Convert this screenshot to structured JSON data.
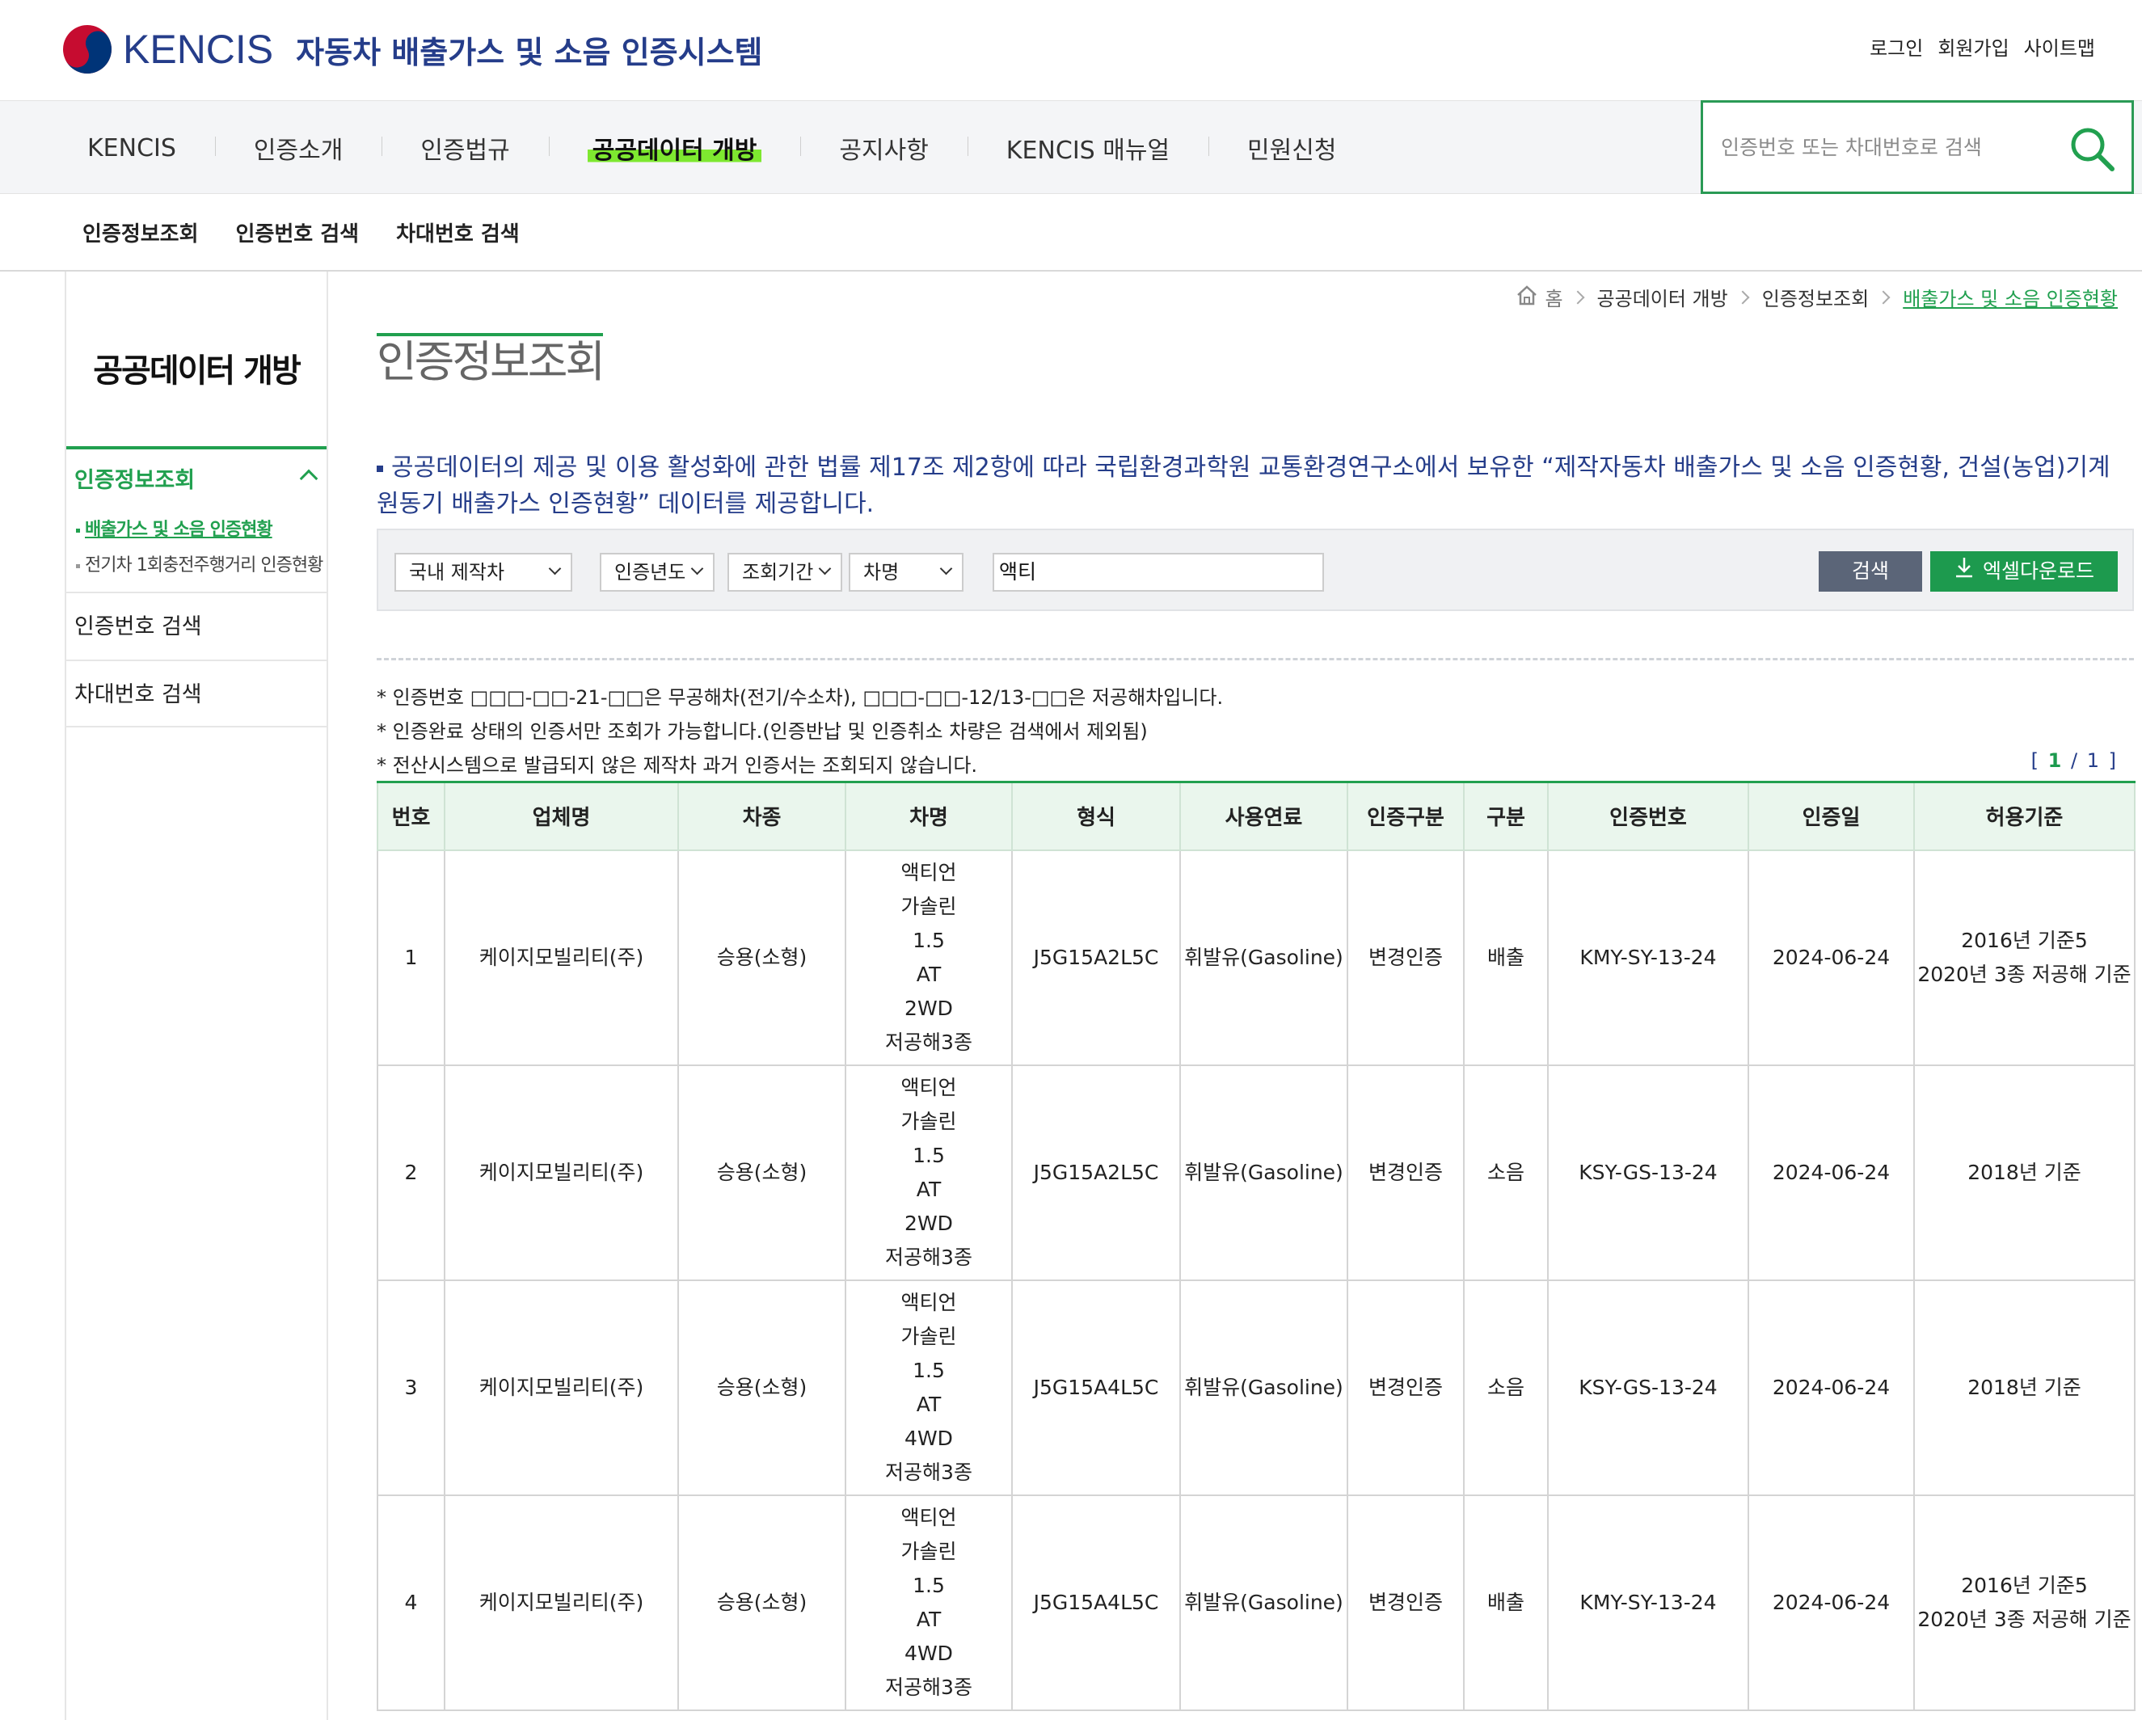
{
  "header": {
    "logo_text": "KENCIS",
    "site_title": "자동차 배출가스 및 소음 인증시스템",
    "util_links": [
      "로그인",
      "회원가입",
      "사이트맵"
    ]
  },
  "gnb": {
    "items": [
      "KENCIS",
      "인증소개",
      "인증법규",
      "공공데이터 개방",
      "공지사항",
      "KENCIS 매뉴얼",
      "민원신청"
    ],
    "active_index": 3,
    "search_placeholder": "인증번호 또는 차대번호로 검색"
  },
  "subnav": [
    "인증정보조회",
    "인증번호 검색",
    "차대번호 검색"
  ],
  "sidebar": {
    "title": "공공데이터 개방",
    "main": "인증정보조회",
    "subs": [
      "배출가스 및 소음 인증현황",
      "전기차 1회충전주행거리 인증현황"
    ],
    "items": [
      "인증번호 검색",
      "차대번호 검색"
    ]
  },
  "breadcrumb": [
    "홈",
    "공공데이터 개방",
    "인증정보조회",
    "배출가스 및 소음 인증현황"
  ],
  "page_title": "인증정보조회",
  "description": "공공데이터의 제공 및 이용 활성화에 관한 법률 제17조 제2항에 따라 국립환경과학원 교통환경연구소에서 보유한 “제작자동차 배출가스 및 소음 인증현황, 건설(농업)기계 원동기 배출가스 인증현황” 데이터를 제공합니다.",
  "filter": {
    "maker": "국내 제작차",
    "year": "인증년도",
    "period": "조회기간",
    "field": "차명",
    "keyword": "액티",
    "search_label": "검색",
    "excel_label": "엑셀다운로드"
  },
  "notes": [
    "* 인증번호 □□□-□□-21-□□은 무공해차(전기/수소차), □□□-□□-12/13-□□은 저공해차입니다.",
    "* 인증완료 상태의 인증서만 조회가 가능합니다.(인증반납 및 인증취소 차량은 검색에서 제외됨)",
    "* 전산시스템으로 발급되지 않은 제작차 과거 인증서는 조회되지 않습니다."
  ],
  "pager": {
    "current": "1",
    "total": "1"
  },
  "table": {
    "headers": [
      "번호",
      "업체명",
      "차종",
      "차명",
      "형식",
      "사용연료",
      "인증구분",
      "구분",
      "인증번호",
      "인증일",
      "허용기준"
    ],
    "rows": [
      {
        "no": "1",
        "company": "케이지모빌리티(주)",
        "type": "승용(소형)",
        "name": [
          "액티언",
          "가솔린",
          "1.5",
          "AT",
          "2WD",
          "저공해3종"
        ],
        "model": "J5G15A2L5C",
        "fuel": "휘발유(Gasoline)",
        "cert_kind": "변경인증",
        "category": "배출",
        "cert_no": "KMY-SY-13-24",
        "date": "2024-06-24",
        "standard": [
          "2016년 기준5",
          "2020년 3종 저공해 기준"
        ]
      },
      {
        "no": "2",
        "company": "케이지모빌리티(주)",
        "type": "승용(소형)",
        "name": [
          "액티언",
          "가솔린",
          "1.5",
          "AT",
          "2WD",
          "저공해3종"
        ],
        "model": "J5G15A2L5C",
        "fuel": "휘발유(Gasoline)",
        "cert_kind": "변경인증",
        "category": "소음",
        "cert_no": "KSY-GS-13-24",
        "date": "2024-06-24",
        "standard": [
          "2018년 기준"
        ]
      },
      {
        "no": "3",
        "company": "케이지모빌리티(주)",
        "type": "승용(소형)",
        "name": [
          "액티언",
          "가솔린",
          "1.5",
          "AT",
          "4WD",
          "저공해3종"
        ],
        "model": "J5G15A4L5C",
        "fuel": "휘발유(Gasoline)",
        "cert_kind": "변경인증",
        "category": "소음",
        "cert_no": "KSY-GS-13-24",
        "date": "2024-06-24",
        "standard": [
          "2018년 기준"
        ]
      },
      {
        "no": "4",
        "company": "케이지모빌리티(주)",
        "type": "승용(소형)",
        "name": [
          "액티언",
          "가솔린",
          "1.5",
          "AT",
          "4WD",
          "저공해3종"
        ],
        "model": "J5G15A4L5C",
        "fuel": "휘발유(Gasoline)",
        "cert_kind": "변경인증",
        "category": "배출",
        "cert_no": "KMY-SY-13-24",
        "date": "2024-06-24",
        "standard": [
          "2016년 기준5",
          "2020년 3종 저공해 기준"
        ]
      }
    ]
  },
  "colors": {
    "brand": "#253d8a",
    "accent": "#21a04f",
    "highlight": "#7ee830"
  }
}
